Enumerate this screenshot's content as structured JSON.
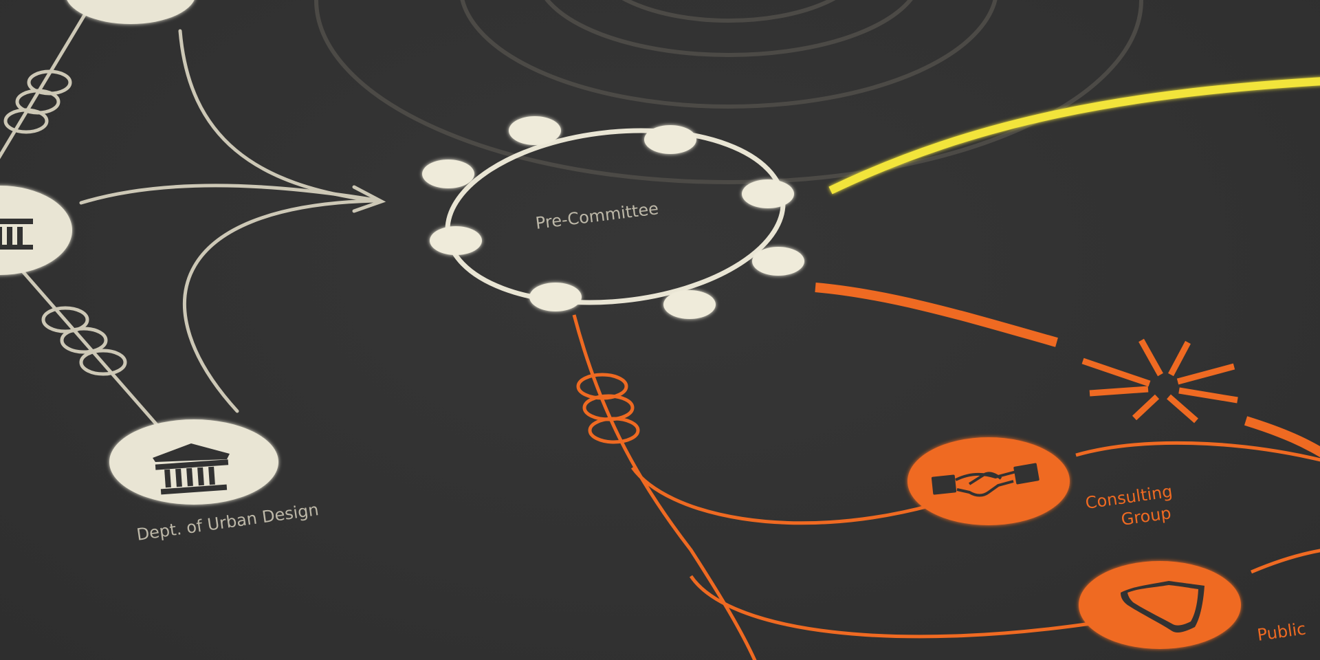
{
  "diagram": {
    "title": "",
    "nodes": {
      "pre_committee": {
        "label": "Pre-Committee"
      },
      "urban_design": {
        "label": "Dept. of Urban Design"
      },
      "consulting_group": {
        "label_line1": "Consulting",
        "label_line2": "Group"
      },
      "public": {
        "label": "Public"
      }
    },
    "icons": {
      "government_building": "bank-building-icon",
      "handshake": "handshake-icon",
      "shield": "shield-icon",
      "starburst": "burst-icon"
    },
    "colors": {
      "background": "#323232",
      "neutral": "#e9e5d4",
      "neutral_line": "#cdc8b6",
      "orange": "#ef6a22",
      "yellow": "#f2e43a",
      "ring_grey": "#4c4a46"
    }
  }
}
